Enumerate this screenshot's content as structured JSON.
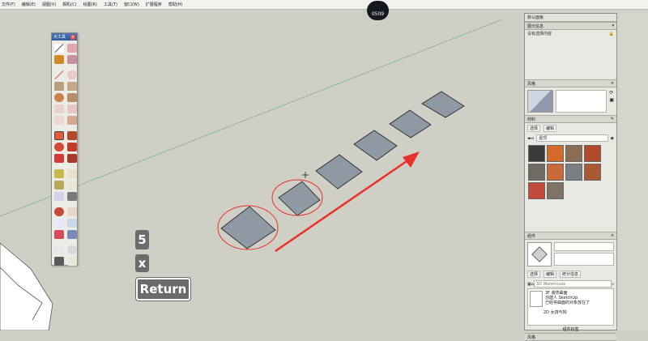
{
  "menu": {
    "items": [
      "文件(F)",
      "编辑(E)",
      "视图(V)",
      "相机(C)",
      "绘图(R)",
      "工具(T)",
      "窗口(W)",
      "扩展程序",
      "帮助(H)"
    ]
  },
  "recording_timer": "0509",
  "toolbar": {
    "title": "大工具"
  },
  "vcb": {
    "key1": "5",
    "key2": "x",
    "key3": "Return"
  },
  "tray": {
    "title": "默认面板",
    "entity_info": {
      "header": "图元信息",
      "message": "没有选择内容"
    },
    "styles": {
      "header": "风格"
    },
    "materials": {
      "header": "材料",
      "tab_select": "选择",
      "tab_edit": "编辑",
      "category": "屋顶"
    },
    "components": {
      "header": "组件",
      "tab_select": "选择",
      "tab_edit": "编辑",
      "tab_stats": "统计信息",
      "search_placeholder": "3D Warehouse",
      "item1_title": "3F 装饰曲面",
      "item1_line1": "创建人 SketchUp",
      "item1_line2": "已经将曲面的对象放在了",
      "item2_title": "2D 女孩与狗",
      "footer": "组件标签"
    },
    "bottom_section": "风格"
  },
  "colors": {
    "canvas": "#cfcfc6",
    "square_fill": "#8e99a4",
    "annotation_red": "#e8312a",
    "axis_green": "#4caf50"
  },
  "materials_swatches": [
    "#3b3b3b",
    "#d46a2a",
    "#8a6d52",
    "#b04a2a",
    "#6f6a62",
    "#c96a3a",
    "#7a7f86",
    "#a95a35",
    "#c24a3a",
    "#7d7466"
  ]
}
